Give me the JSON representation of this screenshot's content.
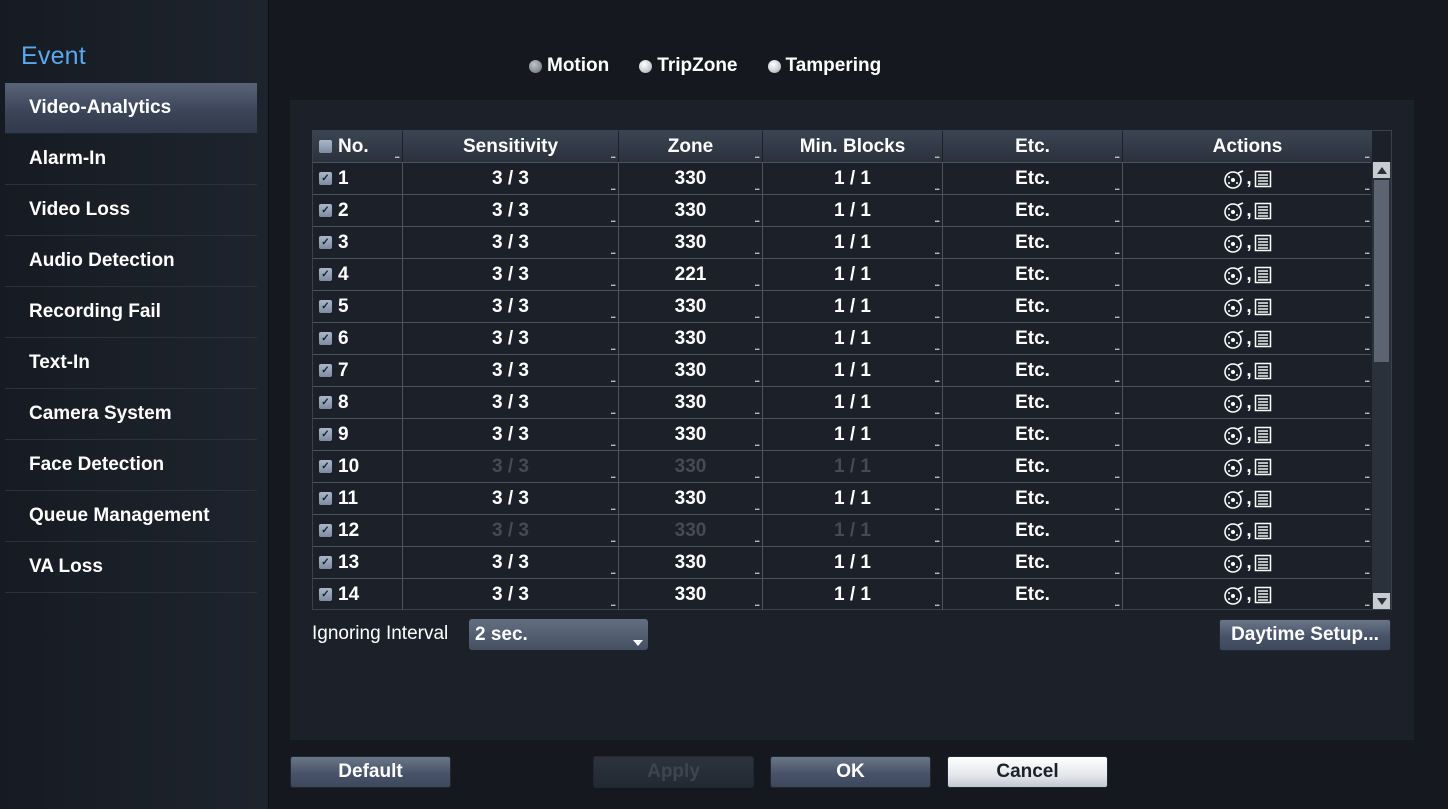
{
  "sidebar": {
    "title": "Event",
    "items": [
      {
        "label": "Video-Analytics",
        "selected": true
      },
      {
        "label": "Alarm-In",
        "selected": false
      },
      {
        "label": "Video Loss",
        "selected": false
      },
      {
        "label": "Audio Detection",
        "selected": false
      },
      {
        "label": "Recording Fail",
        "selected": false
      },
      {
        "label": "Text-In",
        "selected": false
      },
      {
        "label": "Camera System",
        "selected": false
      },
      {
        "label": "Face Detection",
        "selected": false
      },
      {
        "label": "Queue Management",
        "selected": false
      },
      {
        "label": "VA Loss",
        "selected": false
      }
    ]
  },
  "mode_tabs": [
    {
      "label": "Motion",
      "selected": true
    },
    {
      "label": "TripZone",
      "selected": false
    },
    {
      "label": "Tampering",
      "selected": false
    }
  ],
  "table": {
    "headers": {
      "no": "No.",
      "sensitivity": "Sensitivity",
      "zone": "Zone",
      "min_blocks": "Min. Blocks",
      "etc": "Etc.",
      "actions": "Actions"
    },
    "rows": [
      {
        "no": "1",
        "sensitivity": "3 / 3",
        "zone": "330",
        "min_blocks": "1 / 1",
        "etc": "Etc.",
        "enabled": true
      },
      {
        "no": "2",
        "sensitivity": "3 / 3",
        "zone": "330",
        "min_blocks": "1 / 1",
        "etc": "Etc.",
        "enabled": true
      },
      {
        "no": "3",
        "sensitivity": "3 / 3",
        "zone": "330",
        "min_blocks": "1 / 1",
        "etc": "Etc.",
        "enabled": true
      },
      {
        "no": "4",
        "sensitivity": "3 / 3",
        "zone": "221",
        "min_blocks": "1 / 1",
        "etc": "Etc.",
        "enabled": true
      },
      {
        "no": "5",
        "sensitivity": "3 / 3",
        "zone": "330",
        "min_blocks": "1 / 1",
        "etc": "Etc.",
        "enabled": true
      },
      {
        "no": "6",
        "sensitivity": "3 / 3",
        "zone": "330",
        "min_blocks": "1 / 1",
        "etc": "Etc.",
        "enabled": true
      },
      {
        "no": "7",
        "sensitivity": "3 / 3",
        "zone": "330",
        "min_blocks": "1 / 1",
        "etc": "Etc.",
        "enabled": true
      },
      {
        "no": "8",
        "sensitivity": "3 / 3",
        "zone": "330",
        "min_blocks": "1 / 1",
        "etc": "Etc.",
        "enabled": true
      },
      {
        "no": "9",
        "sensitivity": "3 / 3",
        "zone": "330",
        "min_blocks": "1 / 1",
        "etc": "Etc.",
        "enabled": true
      },
      {
        "no": "10",
        "sensitivity": "3 / 3",
        "zone": "330",
        "min_blocks": "1 / 1",
        "etc": "Etc.",
        "enabled": false
      },
      {
        "no": "11",
        "sensitivity": "3 / 3",
        "zone": "330",
        "min_blocks": "1 / 1",
        "etc": "Etc.",
        "enabled": true
      },
      {
        "no": "12",
        "sensitivity": "3 / 3",
        "zone": "330",
        "min_blocks": "1 / 1",
        "etc": "Etc.",
        "enabled": false
      },
      {
        "no": "13",
        "sensitivity": "3 / 3",
        "zone": "330",
        "min_blocks": "1 / 1",
        "etc": "Etc.",
        "enabled": true
      },
      {
        "no": "14",
        "sensitivity": "3 / 3",
        "zone": "330",
        "min_blocks": "1 / 1",
        "etc": "Etc.",
        "enabled": true
      }
    ],
    "action_icons": [
      "alarm-dial-icon",
      "list-icon"
    ]
  },
  "ignoring_interval": {
    "label": "Ignoring Interval",
    "value": "2 sec."
  },
  "buttons": {
    "daytime_setup": "Daytime Setup...",
    "default": "Default",
    "apply": "Apply",
    "ok": "OK",
    "cancel": "Cancel"
  },
  "colors": {
    "accent": "#5aa8f0",
    "background": "#15191f",
    "panel": "#1c2129"
  }
}
